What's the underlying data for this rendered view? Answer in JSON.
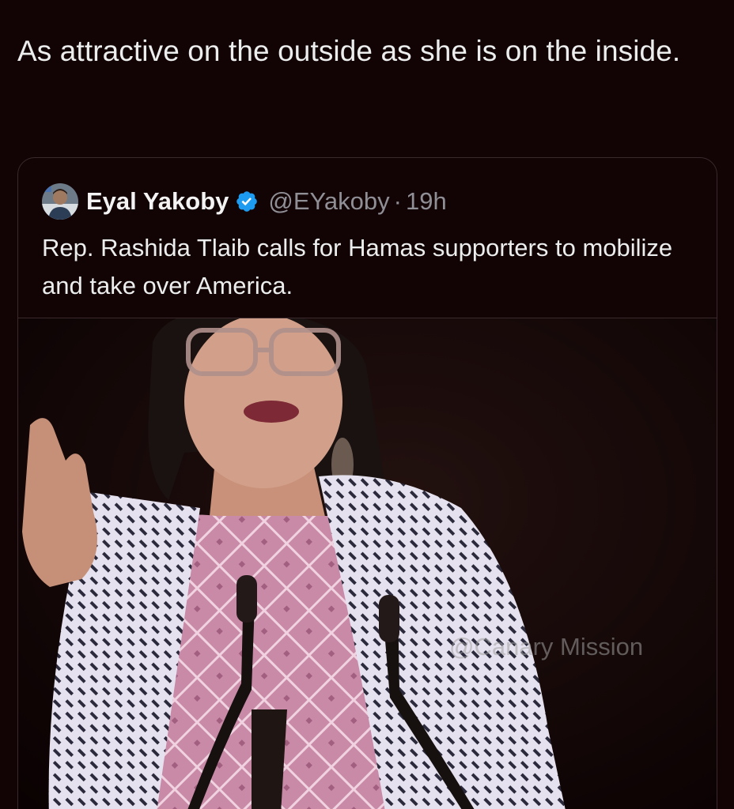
{
  "tweet": {
    "text": "As attractive on the outside as she is on the inside."
  },
  "quoted_tweet": {
    "author_name": "Eyal Yakoby",
    "handle": "@EYakoby",
    "separator": "·",
    "time": "19h",
    "verified": true,
    "verified_icon": "verified-badge-icon",
    "verified_color": "#1d9bf0",
    "text": "Rep. Rashida Tlaib calls for Hamas supporters to mobilize and take over America.",
    "media": {
      "type": "video-still",
      "watermark": "@Canary Mission"
    }
  },
  "colors": {
    "background": "#120305",
    "text_primary": "#eceded",
    "text_secondary": "#8f8f95",
    "border": "#3a2a2d"
  }
}
